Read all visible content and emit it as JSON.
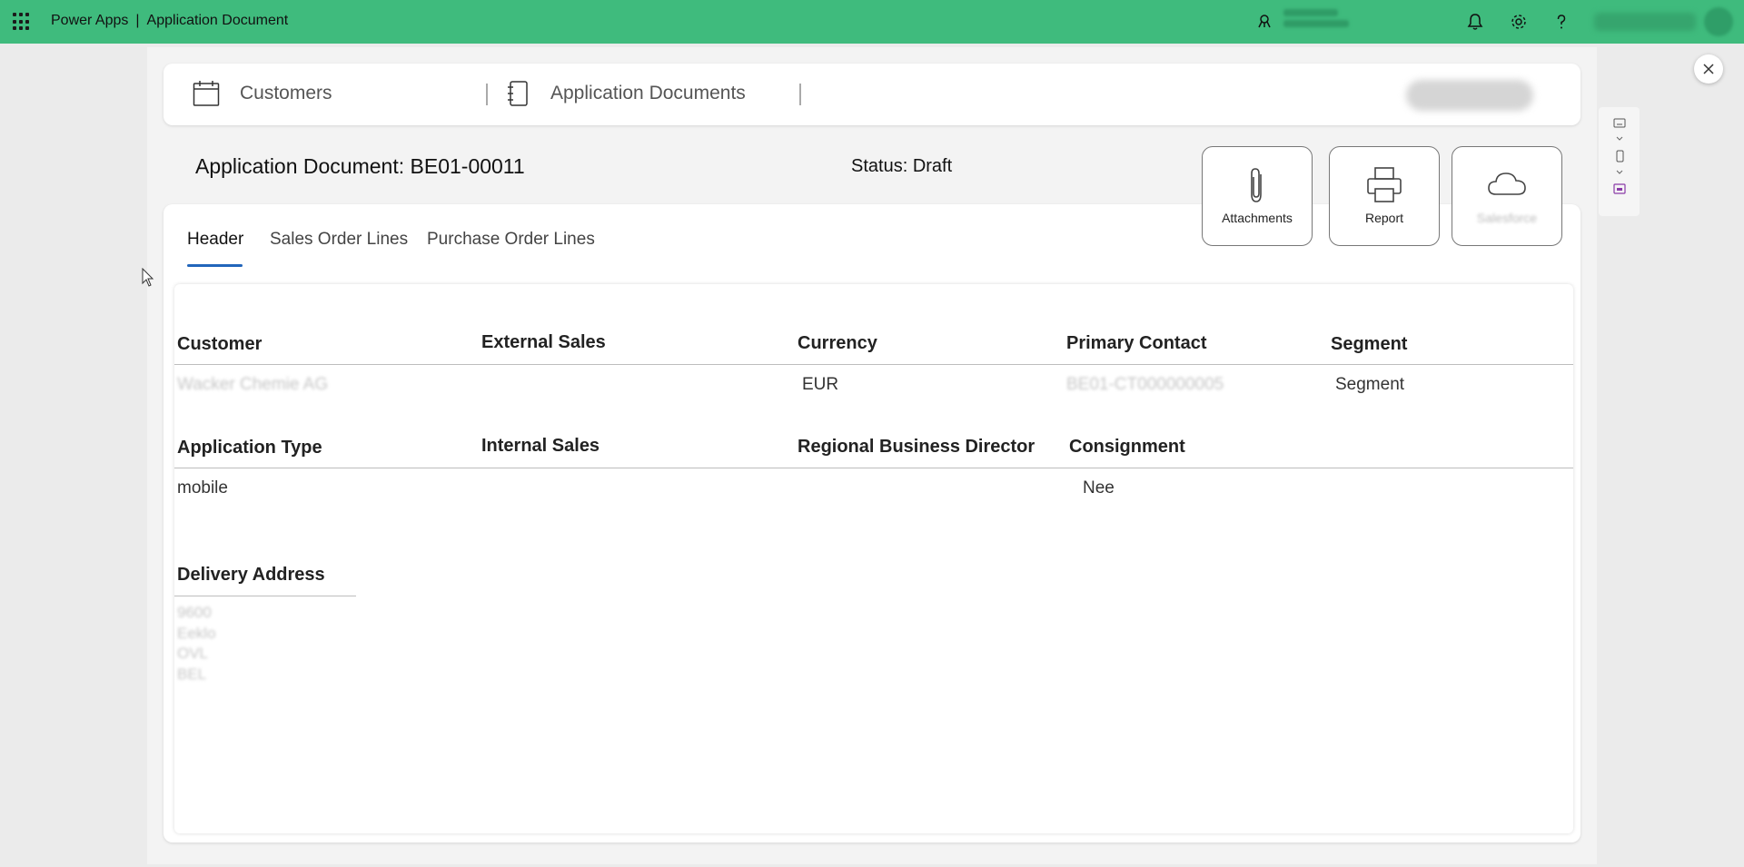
{
  "app": {
    "brand": "Power Apps",
    "separator": "|",
    "title": "Application Document",
    "environment_label": "Environment",
    "environment_name": "dmonter dd",
    "user_name": "DST Coppia Vnai..."
  },
  "breadcrumbs": [
    {
      "label": "Customers",
      "icon": "calendar-icon"
    },
    {
      "label": "Application Documents",
      "icon": "notebook-icon"
    }
  ],
  "document": {
    "title": "Application Document: BE01-00011",
    "status": "Status: Draft"
  },
  "actions": [
    {
      "label": "Attachments",
      "icon": "paperclip-icon"
    },
    {
      "label": "Report",
      "icon": "printer-icon"
    },
    {
      "label": "Salesforce",
      "icon": "cloud-icon"
    }
  ],
  "tabs": [
    {
      "label": "Header",
      "active": true
    },
    {
      "label": "Sales Order Lines",
      "active": false
    },
    {
      "label": "Purchase Order Lines",
      "active": false
    }
  ],
  "fields": {
    "customer": {
      "label": "Customer",
      "value": "Wacker Chemie AG"
    },
    "external_sales": {
      "label": "External Sales",
      "value": ""
    },
    "currency": {
      "label": "Currency",
      "value": "EUR"
    },
    "primary_contact": {
      "label": "Primary Contact",
      "value": "BE01-CT000000005"
    },
    "segment": {
      "label": "Segment",
      "value": "Segment"
    },
    "application_type": {
      "label": "Application Type",
      "value": "mobile"
    },
    "internal_sales": {
      "label": "Internal Sales",
      "value": ""
    },
    "regional_business_director": {
      "label": "Regional Business Director",
      "value": ""
    },
    "consignment": {
      "label": "Consignment",
      "value": "Nee"
    },
    "delivery_address": {
      "label": "Delivery Address",
      "lines": [
        "9600",
        "Eeklo",
        "OVL",
        "BEL"
      ]
    }
  },
  "colors": {
    "topbar": "#3fbb7d",
    "tab_accent": "#2266bb",
    "background": "#ebebeb"
  }
}
